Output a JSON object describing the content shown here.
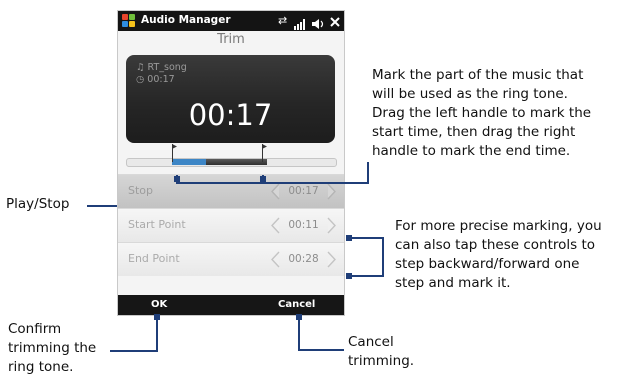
{
  "status_bar": {
    "app_title": "Audio Manager",
    "icons": [
      "windows-logo-icon",
      "connectivity-icon",
      "signal-icon",
      "volume-icon",
      "close-icon"
    ]
  },
  "screen": {
    "heading": "Trim",
    "display": {
      "song_name": "♫ RT_song",
      "song_duration": "◷ 00:17",
      "current_time": "00:17"
    },
    "rows": [
      {
        "label": "Stop",
        "value": "00:17"
      },
      {
        "label": "Start Point",
        "value": "00:11"
      },
      {
        "label": "End Point",
        "value": "00:28"
      }
    ],
    "softkeys": {
      "left": "OK",
      "right": "Cancel"
    }
  },
  "callouts": {
    "mark_part": "Mark the part of the music that\nwill be used as the ring tone.\nDrag the left handle to mark the\nstart time, then drag the right\nhandle to mark the end time.",
    "play_stop": "Play/Stop",
    "precise": "For more precise marking, you\ncan also tap these controls to\nstep backward/forward one\nstep and mark it.",
    "confirm": "Confirm\ntrimming the\nring tone.",
    "cancel": "Cancel\ntrimming."
  },
  "colors": {
    "callout_line": "#1f3e78",
    "selection": "#3d86c6"
  }
}
